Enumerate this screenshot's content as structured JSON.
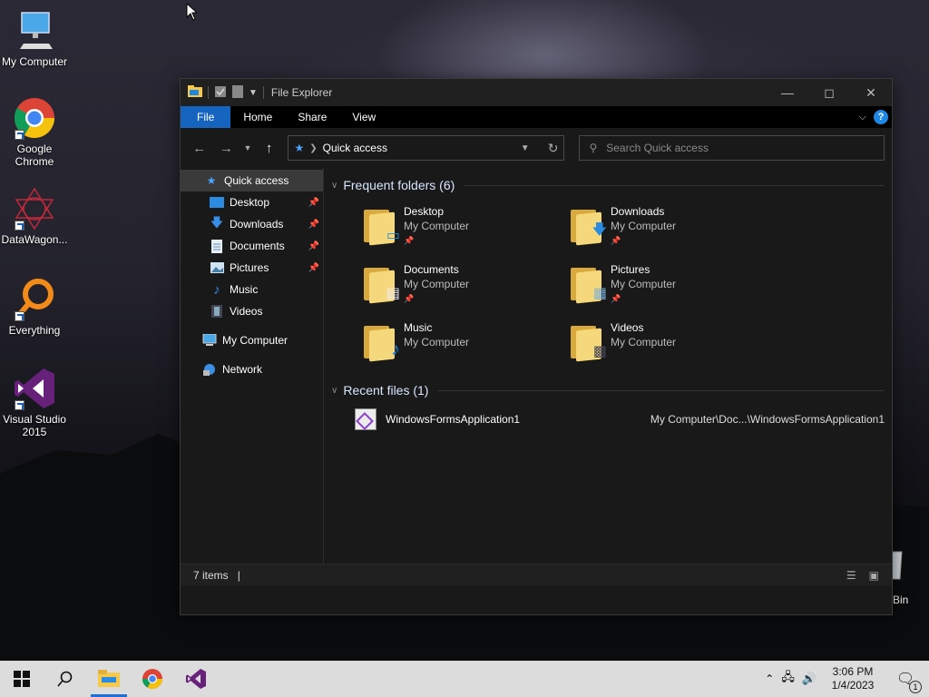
{
  "desktop": {
    "icons": [
      {
        "label": "My Computer"
      },
      {
        "label": "Google Chrome"
      },
      {
        "label": "DataWagon..."
      },
      {
        "label": "Everything"
      },
      {
        "label": "Visual Studio 2015"
      },
      {
        "label": "Bin"
      }
    ]
  },
  "window": {
    "title": "File Explorer",
    "ribbon_tabs": [
      "File",
      "Home",
      "Share",
      "View"
    ],
    "help_label": "?",
    "address": {
      "location": "Quick access"
    },
    "search": {
      "placeholder": "Search Quick access"
    },
    "navpane": {
      "items": [
        {
          "label": "Quick access",
          "icon": "star-icon",
          "selected": true,
          "pinned": false
        },
        {
          "label": "Desktop",
          "icon": "desktop-icon",
          "pinned": true
        },
        {
          "label": "Downloads",
          "icon": "download-icon",
          "pinned": true
        },
        {
          "label": "Documents",
          "icon": "document-icon",
          "pinned": true
        },
        {
          "label": "Pictures",
          "icon": "pictures-icon",
          "pinned": true
        },
        {
          "label": "Music",
          "icon": "music-icon",
          "pinned": false
        },
        {
          "label": "Videos",
          "icon": "videos-icon",
          "pinned": false
        },
        {
          "label": "My Computer",
          "icon": "computer-icon",
          "pinned": false
        },
        {
          "label": "Network",
          "icon": "network-icon",
          "pinned": false
        }
      ]
    },
    "frequent": {
      "heading": "Frequent folders (6)",
      "folders": [
        {
          "name": "Desktop",
          "location": "My Computer",
          "pinned": true
        },
        {
          "name": "Downloads",
          "location": "My Computer",
          "pinned": true
        },
        {
          "name": "Documents",
          "location": "My Computer",
          "pinned": true
        },
        {
          "name": "Pictures",
          "location": "My Computer",
          "pinned": true
        },
        {
          "name": "Music",
          "location": "My Computer",
          "pinned": false
        },
        {
          "name": "Videos",
          "location": "My Computer",
          "pinned": false
        }
      ]
    },
    "recent": {
      "heading": "Recent files (1)",
      "files": [
        {
          "name": "WindowsFormsApplication1",
          "path": "My Computer\\Doc...\\WindowsFormsApplication1"
        }
      ]
    },
    "status": {
      "items": "7 items"
    }
  },
  "taskbar": {
    "time": "3:06 PM",
    "date": "1/4/2023",
    "notification_count": "1"
  },
  "colors": {
    "accent": "#1565c0",
    "folder": "#f6d87c",
    "window_bg": "#191919",
    "taskbar_bg": "#dcdcdc"
  }
}
